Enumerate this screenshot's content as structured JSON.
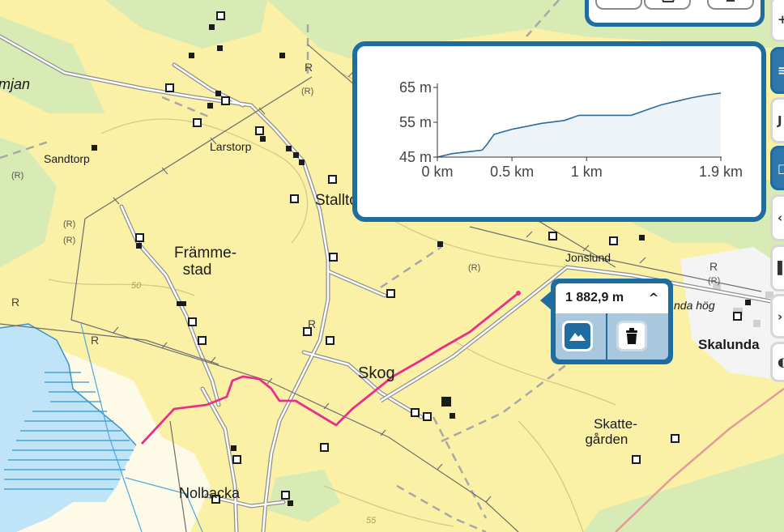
{
  "map": {
    "places": [
      {
        "id": "mjan",
        "text": "mjan"
      },
      {
        "id": "sandtorp",
        "text": "Sandtorp"
      },
      {
        "id": "larstorp",
        "text": "Larstorp"
      },
      {
        "id": "stallto",
        "text": "Stallto"
      },
      {
        "id": "fremmestad",
        "lines": [
          "Främme-",
          "stad"
        ]
      },
      {
        "id": "jonslund",
        "text": "Jonslund"
      },
      {
        "id": "skalunda-hog",
        "text": "nda hög"
      },
      {
        "id": "skalunda",
        "text": "Skalunda"
      },
      {
        "id": "skog",
        "text": "Skog"
      },
      {
        "id": "skattegarden",
        "lines": [
          "Skatte-",
          "gården"
        ]
      },
      {
        "id": "nolbacka",
        "text": "Nolbacka"
      }
    ],
    "contour_labels": [
      "50",
      "55"
    ],
    "ancient_marker": "R",
    "colors": {
      "open_land": "#fbf1a6",
      "forest": "#d8ebb4",
      "water": "#bfe3f7",
      "route": "#ea2f8a",
      "accent": "#1f6da0"
    }
  },
  "elevation_profile": {
    "chart_data": {
      "type": "area",
      "title": "",
      "xlabel": "",
      "ylabel": "",
      "x_unit": "km",
      "y_unit": "m",
      "xlim": [
        0,
        1.9
      ],
      "ylim": [
        45,
        65
      ],
      "x_ticks": [
        0,
        0.5,
        1,
        1.9
      ],
      "y_ticks": [
        45,
        55,
        65
      ],
      "x_tick_labels": [
        "0 km",
        "0.5 km",
        "1 km",
        "1.9 km"
      ],
      "y_tick_labels": [
        "45 m",
        "55 m",
        "65 m"
      ],
      "grid": false,
      "series": [
        {
          "x": [
            0,
            0.1,
            0.2,
            0.3,
            0.33,
            0.38,
            0.5,
            0.7,
            0.85,
            0.95,
            1.0,
            1.2,
            1.3,
            1.4,
            1.5,
            1.6,
            1.7,
            1.8,
            1.9
          ],
          "y": [
            45,
            46.0,
            46.5,
            47.0,
            48.5,
            51.5,
            53.0,
            54.7,
            55.5,
            57.0,
            57.0,
            57.0,
            57.0,
            58.5,
            60.0,
            61.0,
            62.0,
            62.8,
            63.4
          ]
        }
      ]
    },
    "colors": {
      "line": "#2b6c9a",
      "fill": "#edf4f9",
      "axis": "#333333"
    }
  },
  "measure_popup": {
    "distance": "1 882,9 m",
    "caret_icon": "chevron-up-icon",
    "elevation_button_icon": "mountain-icon",
    "delete_button_icon": "trash-icon"
  }
}
